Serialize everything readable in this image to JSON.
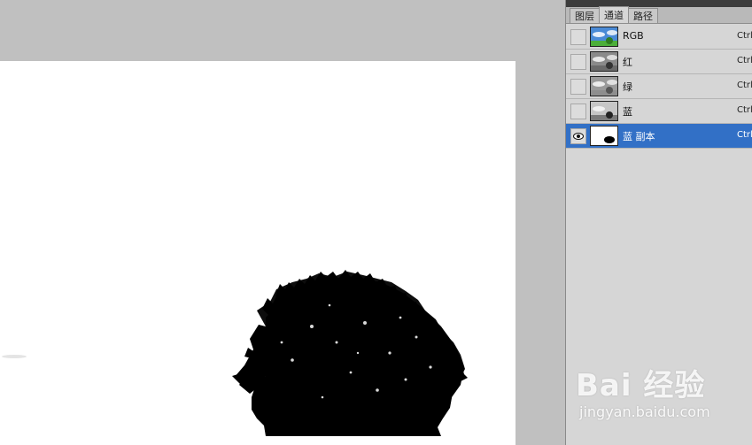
{
  "panel": {
    "tabs": [
      {
        "label": "图层"
      },
      {
        "label": "通道"
      },
      {
        "label": "路径"
      }
    ],
    "active_tab": "通道",
    "channels": [
      {
        "name": "RGB",
        "shortcut": "Ctrl+",
        "visible": false,
        "selected": false
      },
      {
        "name": "红",
        "shortcut": "Ctrl+",
        "visible": false,
        "selected": false
      },
      {
        "name": "绿",
        "shortcut": "Ctrl+",
        "visible": false,
        "selected": false
      },
      {
        "name": "蓝",
        "shortcut": "Ctrl+",
        "visible": false,
        "selected": false
      },
      {
        "name": "蓝 副本",
        "shortcut": "Ctrl+",
        "visible": true,
        "selected": true
      }
    ]
  },
  "watermark": {
    "brand": "Bai 经验",
    "url": "jingyan.baidu.com"
  },
  "colors": {
    "selection": "#3270c6",
    "workspace": "#c0c0c0",
    "panel": "#d6d6d6"
  }
}
